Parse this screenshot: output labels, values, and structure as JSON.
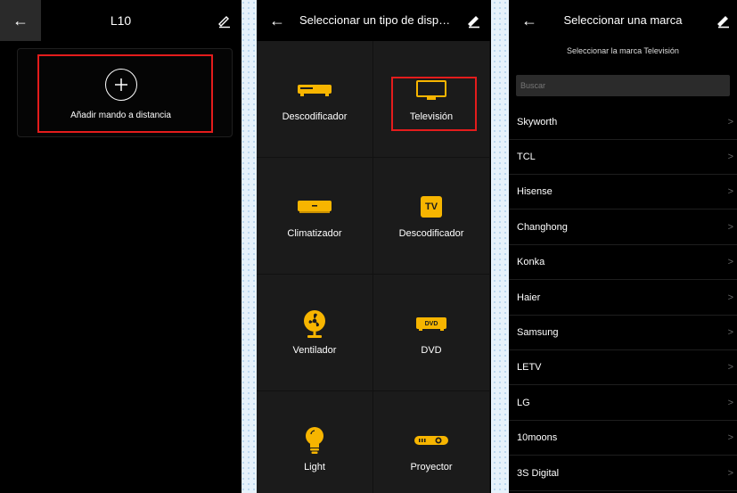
{
  "panel1": {
    "title": "L10",
    "add_label": "Añadir mando a distancia"
  },
  "panel2": {
    "title": "Seleccionar un tipo de disp…",
    "devices": [
      {
        "label": "Descodificador",
        "icon": "set-top-box-icon"
      },
      {
        "label": "Televisión",
        "icon": "tv-icon"
      },
      {
        "label": "Climatizador",
        "icon": "air-conditioner-icon"
      },
      {
        "label": "Descodificador",
        "icon": "tv-box-icon"
      },
      {
        "label": "Ventilador",
        "icon": "fan-icon"
      },
      {
        "label": "DVD",
        "icon": "dvd-icon"
      },
      {
        "label": "Light",
        "icon": "light-bulb-icon"
      },
      {
        "label": "Proyector",
        "icon": "projector-icon"
      }
    ],
    "tv_badge": "TV",
    "dvd_badge": "DVD"
  },
  "panel3": {
    "title": "Seleccionar una marca",
    "subtitle": "Seleccionar la marca Televisión",
    "search_placeholder": "Buscar",
    "brands": [
      "Skyworth",
      "TCL",
      "Hisense",
      "Changhong",
      "Konka",
      "Haier",
      "Samsung",
      "LETV",
      "LG",
      "10moons",
      "3S Digital"
    ]
  },
  "colors": {
    "accent": "#f7b500",
    "highlight": "#e41c1c",
    "cell_bg": "#1b1b1b",
    "background": "#000000"
  }
}
